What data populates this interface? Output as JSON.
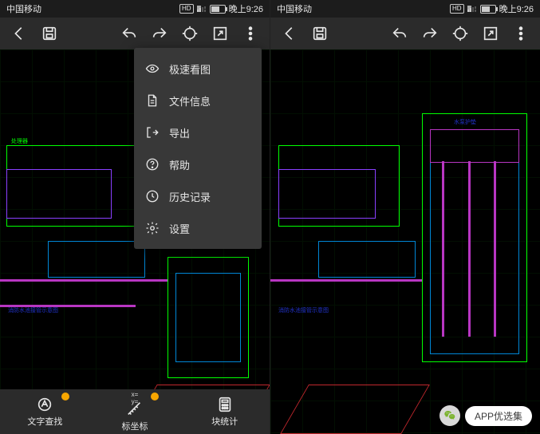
{
  "statusbar": {
    "carrier": "中国移动",
    "time_prefix": "晚上",
    "time": "9:26",
    "hd_label": "HD"
  },
  "menu": {
    "items": [
      {
        "icon": "eye-icon",
        "label": "极速看图"
      },
      {
        "icon": "file-icon",
        "label": "文件信息"
      },
      {
        "icon": "export-icon",
        "label": "导出"
      },
      {
        "icon": "help-icon",
        "label": "帮助"
      },
      {
        "icon": "history-icon",
        "label": "历史记录"
      },
      {
        "icon": "settings-icon",
        "label": "设置"
      }
    ]
  },
  "bottomnav": {
    "items": [
      {
        "label": "文字查找",
        "sub": ""
      },
      {
        "label": "标坐标",
        "sub": "x=\ny="
      },
      {
        "label": "块统计",
        "sub": ""
      }
    ]
  },
  "canvas": {
    "caption_left": "消防水池接管示意图",
    "label_a": "处理器",
    "label_b": "水泵护垫"
  },
  "watermark": {
    "text": "APP优选集"
  }
}
